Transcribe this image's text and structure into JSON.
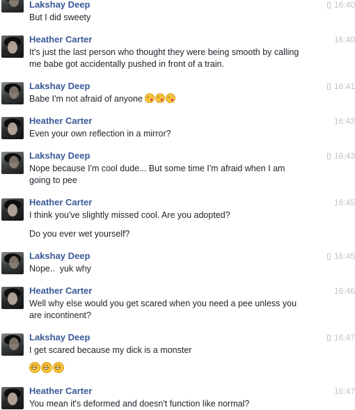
{
  "messages": [
    {
      "sender": "Lakshay Deep",
      "time": "16:40",
      "mobile": true,
      "lines": [
        "But I did sweety"
      ]
    },
    {
      "sender": "Heather Carter",
      "time": "16:40",
      "mobile": false,
      "lines": [
        "It's just the last person who thought they were being smooth by calling",
        "me babe got accidentally pushed in front of a train."
      ]
    },
    {
      "sender": "Lakshay Deep",
      "time": "16:41",
      "mobile": true,
      "lines": [
        "Babe I'm not afraid of anyone"
      ],
      "emoji": [
        "face-throwing-kiss",
        "face-throwing-kiss",
        "face-throwing-kiss"
      ]
    },
    {
      "sender": "Heather Carter",
      "time": "16:42",
      "mobile": false,
      "lines": [
        "Even your own reflection in a mirror?"
      ]
    },
    {
      "sender": "Lakshay Deep",
      "time": "16:43",
      "mobile": true,
      "lines": [
        "Nope because I'm cool dude... But some time I'm afraid when I am",
        "going to pee"
      ]
    },
    {
      "sender": "Heather Carter",
      "time": "16:45",
      "mobile": false,
      "lines": [
        "I think you've slightly missed cool. Are you adopted?"
      ],
      "extra": "Do you ever wet yourself?"
    },
    {
      "sender": "Lakshay Deep",
      "time": "16:45",
      "mobile": true,
      "lines": [
        "Nope..  yuk why"
      ]
    },
    {
      "sender": "Heather Carter",
      "time": "16:46",
      "mobile": false,
      "lines": [
        "Well why else would you get scared when you need a pee unless you",
        "are incontinent?"
      ]
    },
    {
      "sender": "Lakshay Deep",
      "time": "16:47",
      "mobile": true,
      "lines": [
        "I get scared because my dick is a monster"
      ],
      "emoji_line": [
        "grinning-face",
        "grinning-face",
        "grinning-face"
      ]
    },
    {
      "sender": "Heather Carter",
      "time": "16:47",
      "mobile": false,
      "lines": [
        "You mean it's deformed and doesn't function like normal?"
      ]
    }
  ]
}
